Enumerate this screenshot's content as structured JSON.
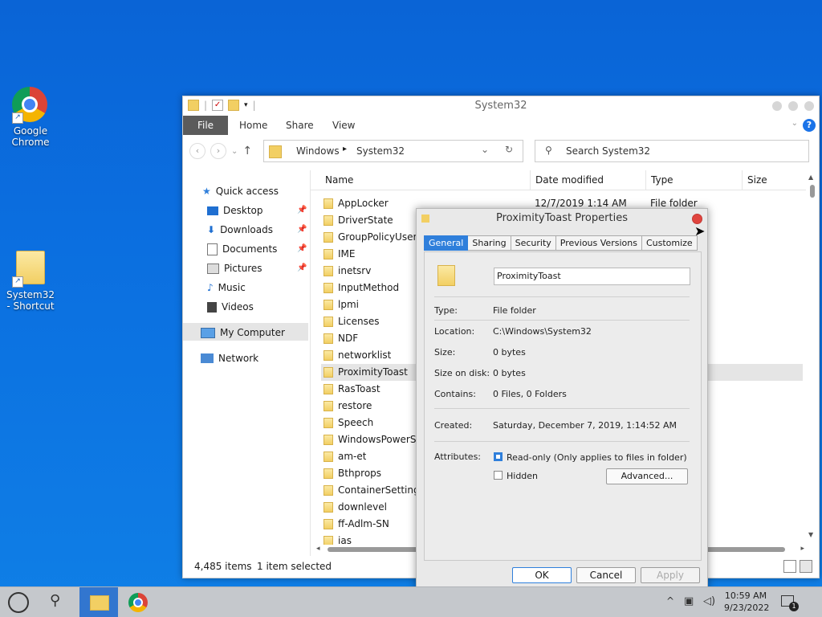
{
  "desktop": {
    "icons": [
      {
        "label": "Google Chrome",
        "icon": "chrome-icon"
      },
      {
        "label": "System32 - Shortcut",
        "icon": "folder-shortcut-icon"
      }
    ]
  },
  "explorer": {
    "title": "System32",
    "ribbon_tabs": [
      "File",
      "Home",
      "Share",
      "View"
    ],
    "address": {
      "segments": [
        "Windows",
        "System32"
      ]
    },
    "search_placeholder": "Search System32",
    "quick_access_label": "Quick access",
    "nav_items": [
      {
        "label": "Desktop",
        "pinned": true
      },
      {
        "label": "Downloads",
        "pinned": true
      },
      {
        "label": "Documents",
        "pinned": true
      },
      {
        "label": "Pictures",
        "pinned": true
      },
      {
        "label": "Music",
        "pinned": false
      },
      {
        "label": "Videos",
        "pinned": false
      }
    ],
    "my_computer_label": "My Computer",
    "network_label": "Network",
    "columns": [
      "Name",
      "Date modified",
      "Type",
      "Size"
    ],
    "files": [
      {
        "name": "AppLocker",
        "date": "12/7/2019 1:14 AM",
        "type": "File folder"
      },
      {
        "name": "DriverState"
      },
      {
        "name": "GroupPolicyUsers"
      },
      {
        "name": "IME"
      },
      {
        "name": "inetsrv"
      },
      {
        "name": "InputMethod"
      },
      {
        "name": "lpmi"
      },
      {
        "name": "Licenses"
      },
      {
        "name": "NDF"
      },
      {
        "name": "networklist"
      },
      {
        "name": "ProximityToast",
        "selected": true
      },
      {
        "name": "RasToast"
      },
      {
        "name": "restore"
      },
      {
        "name": "Speech"
      },
      {
        "name": "WindowsPowerSh"
      },
      {
        "name": "am-et"
      },
      {
        "name": "Bthprops"
      },
      {
        "name": "ContainerSettings"
      },
      {
        "name": "downlevel"
      },
      {
        "name": "ff-Adlm-SN"
      },
      {
        "name": "ias"
      }
    ],
    "status": {
      "items": "4,485 items",
      "selected": "1 item selected"
    }
  },
  "dialog": {
    "title": "ProximityToast Properties",
    "tabs": [
      "General",
      "Sharing",
      "Security",
      "Previous Versions",
      "Customize"
    ],
    "name_value": "ProximityToast",
    "fields": {
      "type_label": "Type:",
      "type_value": "File folder",
      "location_label": "Location:",
      "location_value": "C:\\Windows\\System32",
      "size_label": "Size:",
      "size_value": "0 bytes",
      "disk_label": "Size on disk:",
      "disk_value": "0 bytes",
      "contains_label": "Contains:",
      "contains_value": "0 Files, 0 Folders",
      "created_label": "Created:",
      "created_value": "Saturday, December 7, 2019, 1:14:52 AM",
      "attributes_label": "Attributes:",
      "readonly_label": "Read-only (Only applies to files in folder)",
      "readonly_checked": true,
      "hidden_label": "Hidden",
      "hidden_checked": false,
      "advanced_label": "Advanced..."
    },
    "buttons": {
      "ok": "OK",
      "cancel": "Cancel",
      "apply": "Apply"
    }
  },
  "taskbar": {
    "time": "10:59 AM",
    "date": "9/23/2022",
    "notification_count": "1"
  },
  "colors": {
    "accent": "#2f7fdb",
    "close": "#e0443e",
    "selection": "#e5e5e5"
  }
}
